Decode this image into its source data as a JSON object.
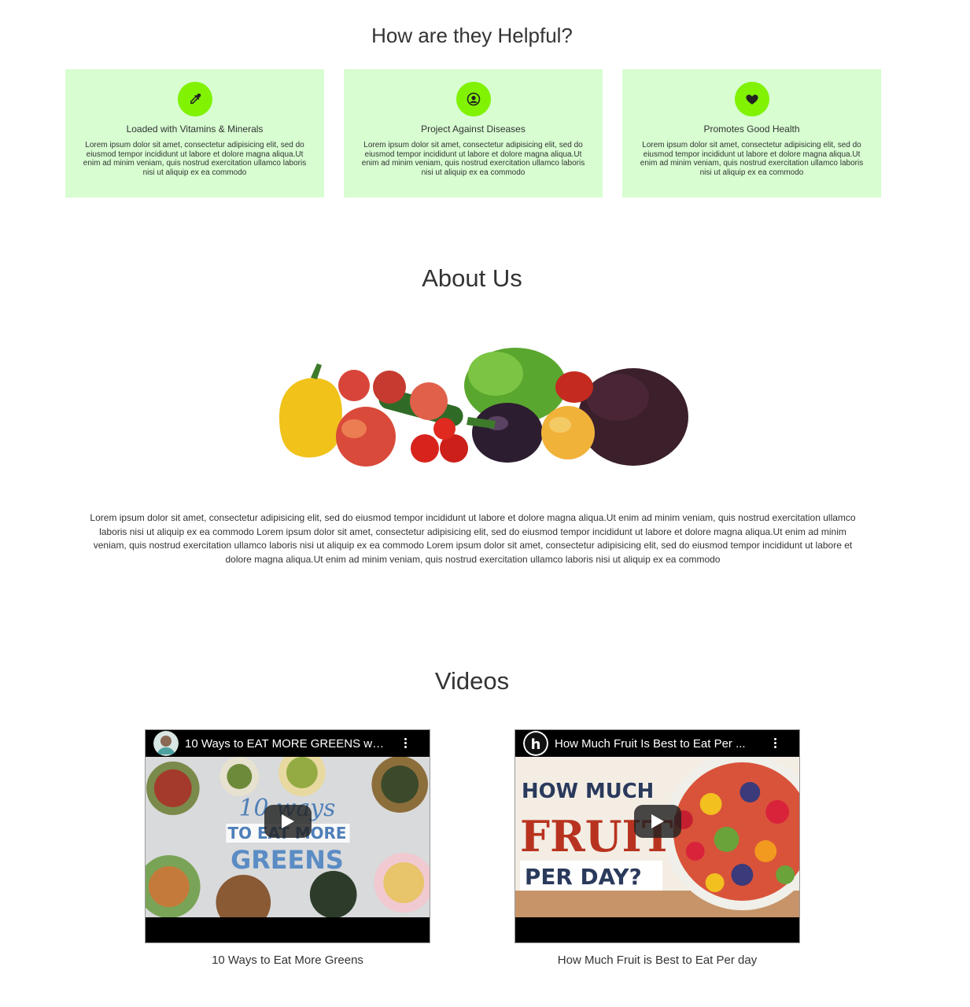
{
  "helpful": {
    "title": "How are they Helpful?",
    "cards": [
      {
        "icon": "eyedropper-icon",
        "title": "Loaded with Vitamins & Minerals",
        "text": "Lorem ipsum dolor sit amet, consectetur adipisicing elit, sed do eiusmod tempor incididunt ut labore et dolore magna aliqua.Ut enim ad minim veniam, quis nostrud exercitation ullamco laboris nisi ut aliquip ex ea commodo"
      },
      {
        "icon": "user-circle-icon",
        "title": "Project Against Diseases",
        "text": "Lorem ipsum dolor sit amet, consectetur adipisicing elit, sed do eiusmod tempor incididunt ut labore et dolore magna aliqua.Ut enim ad minim veniam, quis nostrud exercitation ullamco laboris nisi ut aliquip ex ea commodo"
      },
      {
        "icon": "heart-icon",
        "title": "Promotes Good Health",
        "text": "Lorem ipsum dolor sit amet, consectetur adipisicing elit, sed do eiusmod tempor incididunt ut labore et dolore magna aliqua.Ut enim ad minim veniam, quis nostrud exercitation ullamco laboris nisi ut aliquip ex ea commodo"
      }
    ]
  },
  "about": {
    "title": "About Us",
    "text": "Lorem ipsum dolor sit amet, consectetur adipisicing elit, sed do eiusmod tempor incididunt ut labore et dolore magna aliqua.Ut enim ad minim veniam, quis nostrud exercitation ullamco laboris nisi ut aliquip ex ea commodo Lorem ipsum dolor sit amet, consectetur adipisicing elit, sed do eiusmod tempor incididunt ut labore et dolore magna aliqua.Ut enim ad minim veniam, quis nostrud exercitation ullamco laboris nisi ut aliquip ex ea commodo Lorem ipsum dolor sit amet, consectetur adipisicing elit, sed do eiusmod tempor incididunt ut labore et dolore magna aliqua.Ut enim ad minim veniam, quis nostrud exercitation ullamco laboris nisi ut aliquip ex ea commodo"
  },
  "videos": {
    "title": "Videos",
    "items": [
      {
        "embed_title": "10 Ways to EAT MORE GREENS wit...",
        "caption": "10 Ways to Eat More Greens",
        "thumb_lines": [
          "10 ways",
          "TO EAT MORE",
          "GREENS"
        ]
      },
      {
        "embed_title": "How Much Fruit Is Best to Eat Per ...",
        "caption": "How Much Fruit is Best to Eat Per day",
        "thumb_lines": [
          "HOW MUCH",
          "FRUIT",
          "PER DAY?"
        ],
        "channel_letter": "h"
      }
    ]
  },
  "colors": {
    "card_bg": "#d7fdd1",
    "icon_bg": "#80f202"
  }
}
